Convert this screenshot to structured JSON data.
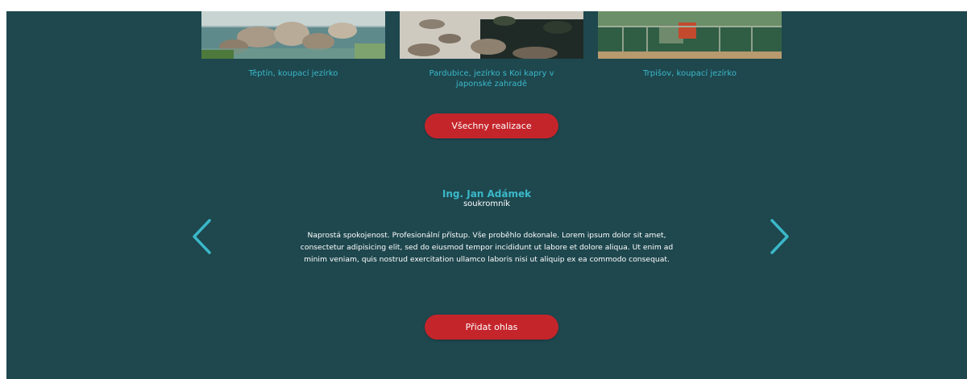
{
  "gallery": {
    "items": [
      {
        "caption": "Těptín, koupací jezírko"
      },
      {
        "caption": "Pardubice, jezírko s Koi kapry v japonské zahradě"
      },
      {
        "caption": "Trpišov, koupací jezírko"
      }
    ],
    "all_button_label": "Všechny realizace"
  },
  "testimonial": {
    "name": "Ing. Jan Adámek",
    "role": "soukromník",
    "text": "Naprostá spokojenost. Profesionální přístup. Vše proběhlo dokonale. Lorem ipsum dolor sit amet, consectetur adipisicing elit, sed do eiusmod tempor incididunt ut labore et dolore aliqua. Ut enim ad minim veniam, quis nostrud exercitation ullamco laboris nisi ut aliquip ex ea commodo consequat.",
    "prev_icon": "chevron-left-icon",
    "next_icon": "chevron-right-icon",
    "add_button_label": "Přidat ohlas"
  },
  "colors": {
    "background": "#1e474e",
    "accent": "#3bb8c9",
    "button": "#c4252b",
    "text": "#ffffff"
  }
}
